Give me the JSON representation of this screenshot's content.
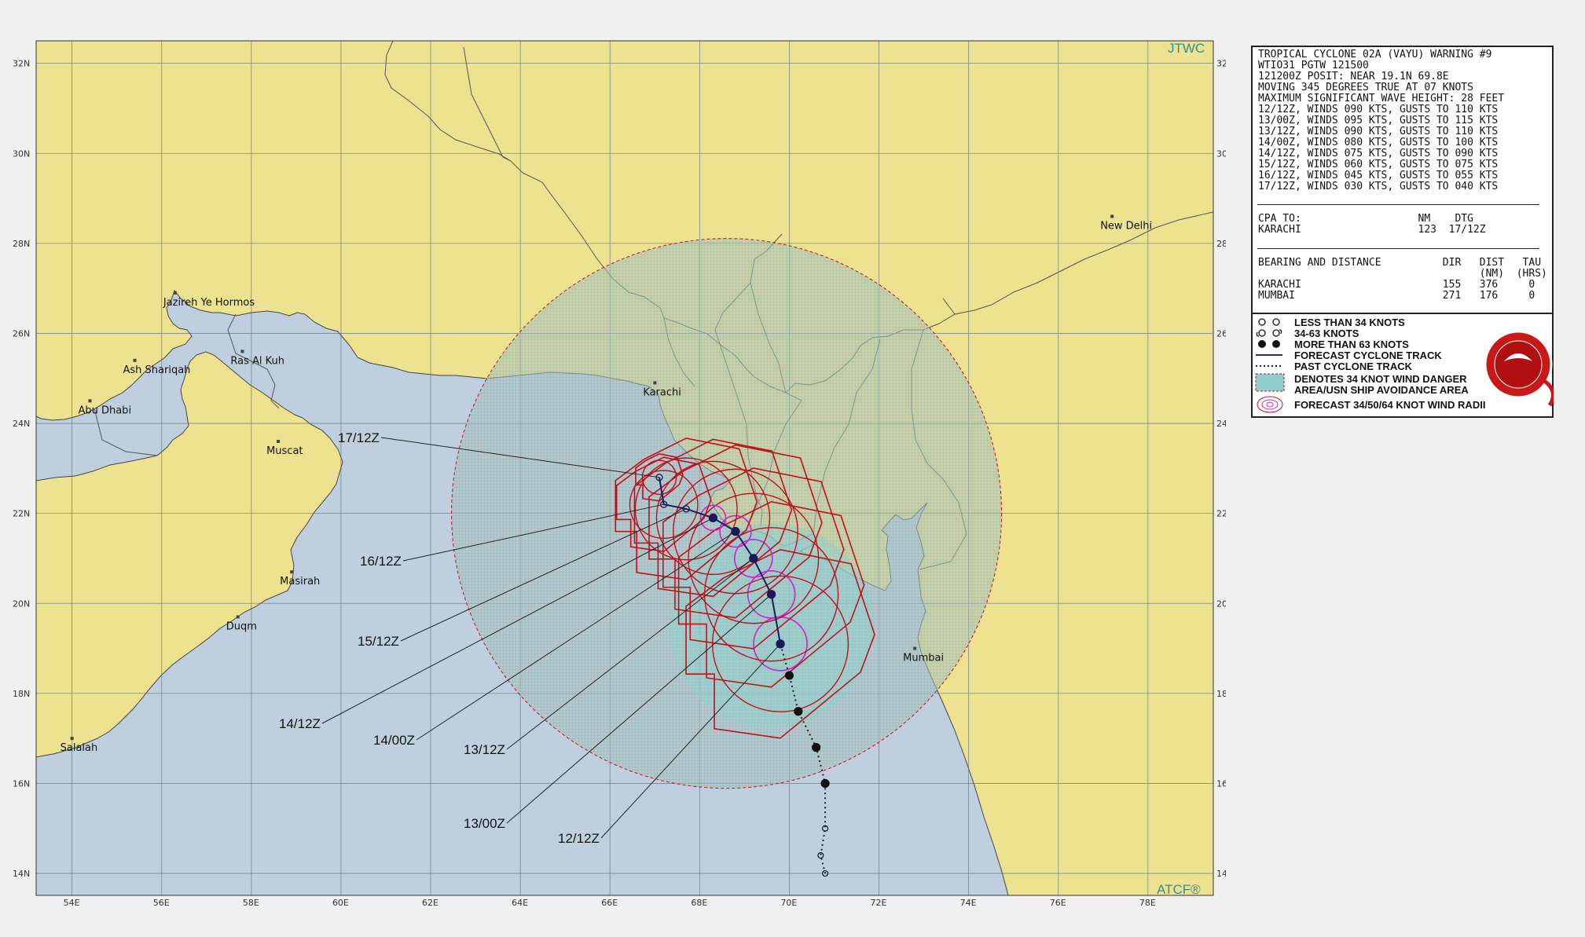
{
  "branding": {
    "top_right": "JTWC",
    "bottom_right": "ATCF®"
  },
  "colors": {
    "ocean": "#c0cfdf",
    "land": "#ede28f",
    "danger_fill": "#8fd0cc",
    "radii_red": "#c0101a",
    "radii_magenta": "#cc22cc",
    "track": "#1a1a5a",
    "border": "#222222"
  },
  "axes": {
    "lon_labels": [
      "54E",
      "56E",
      "58E",
      "60E",
      "62E",
      "64E",
      "66E",
      "68E",
      "70E",
      "72E",
      "74E",
      "76E",
      "78E"
    ],
    "lat_labels": [
      "32N",
      "30N",
      "28N",
      "26N",
      "24N",
      "22N",
      "20N",
      "18N",
      "16N",
      "14N"
    ]
  },
  "places": [
    {
      "name": "Jazireh Ye Hormos",
      "lon": 56.3,
      "lat": 26.9
    },
    {
      "name": "Ras Al Kuh",
      "lon": 57.8,
      "lat": 25.6
    },
    {
      "name": "Ash Shariqah",
      "lon": 55.4,
      "lat": 25.4
    },
    {
      "name": "Abu Dhabi",
      "lon": 54.4,
      "lat": 24.5
    },
    {
      "name": "Muscat",
      "lon": 58.6,
      "lat": 23.6
    },
    {
      "name": "Masirah",
      "lon": 58.9,
      "lat": 20.7
    },
    {
      "name": "Duqm",
      "lon": 57.7,
      "lat": 19.7
    },
    {
      "name": "Salalah",
      "lon": 54.0,
      "lat": 17.0
    },
    {
      "name": "Karachi",
      "lon": 67.0,
      "lat": 24.9
    },
    {
      "name": "Mumbai",
      "lon": 72.8,
      "lat": 19.0
    },
    {
      "name": "New Delhi",
      "lon": 77.2,
      "lat": 28.6
    }
  ],
  "forecast_points": [
    {
      "label": "12/12Z",
      "lon": 69.8,
      "lat": 19.1
    },
    {
      "label": "13/00Z",
      "lon": 69.6,
      "lat": 20.2
    },
    {
      "label": "13/12Z",
      "lon": 69.2,
      "lat": 21.0
    },
    {
      "label": "14/00Z",
      "lon": 68.8,
      "lat": 21.6
    },
    {
      "label": "14/12Z",
      "lon": 68.3,
      "lat": 21.9
    },
    {
      "label": "15/12Z",
      "lon": 67.7,
      "lat": 22.1
    },
    {
      "label": "16/12Z",
      "lon": 67.2,
      "lat": 22.2
    },
    {
      "label": "17/12Z",
      "lon": 67.1,
      "lat": 22.8
    }
  ],
  "past_track": [
    {
      "lon": 70.8,
      "lat": 14.0
    },
    {
      "lon": 70.7,
      "lat": 14.4
    },
    {
      "lon": 70.8,
      "lat": 15.0
    },
    {
      "lon": 70.8,
      "lat": 16.0
    },
    {
      "lon": 70.6,
      "lat": 16.8
    },
    {
      "lon": 70.2,
      "lat": 17.6
    },
    {
      "lon": 70.0,
      "lat": 18.4
    },
    {
      "lon": 69.8,
      "lat": 19.1
    }
  ],
  "panel": {
    "header": [
      "TROPICAL CYCLONE 02A (VAYU) WARNING #9",
      "WTIO31 PGTW 121500",
      "121200Z POSIT: NEAR 19.1N 69.8E",
      "MOVING 345 DEGREES TRUE AT 07 KNOTS",
      "MAXIMUM SIGNIFICANT WAVE HEIGHT: 28 FEET",
      "12/12Z, WINDS 090 KTS, GUSTS TO 110 KTS",
      "13/00Z, WINDS 095 KTS, GUSTS TO 115 KTS",
      "13/12Z, WINDS 090 KTS, GUSTS TO 110 KTS",
      "14/00Z, WINDS 080 KTS, GUSTS TO 100 KTS",
      "14/12Z, WINDS 075 KTS, GUSTS TO 090 KTS",
      "15/12Z, WINDS 060 KTS, GUSTS TO 075 KTS",
      "16/12Z, WINDS 045 KTS, GUSTS TO 055 KTS",
      "17/12Z, WINDS 030 KTS, GUSTS TO 040 KTS"
    ],
    "cpa": [
      "CPA TO:                   NM    DTG",
      "KARACHI                   123  17/12Z"
    ],
    "bearing": [
      "BEARING AND DISTANCE          DIR   DIST   TAU",
      "                                    (NM)  (HRS)",
      "KARACHI                       155   376     0",
      "MUMBAI                        271   176     0"
    ]
  },
  "legend": {
    "less_34": "LESS THAN 34 KNOTS",
    "k34_63": "34-63 KNOTS",
    "more_63": "MORE THAN 63 KNOTS",
    "forecast_track": "FORECAST CYCLONE TRACK",
    "past_track": "PAST CYCLONE TRACK",
    "danger1": "DENOTES 34 KNOT WIND DANGER",
    "danger2": "AREA/USN SHIP AVOIDANCE AREA",
    "radii": "FORECAST 34/50/64 KNOT WIND RADII"
  }
}
